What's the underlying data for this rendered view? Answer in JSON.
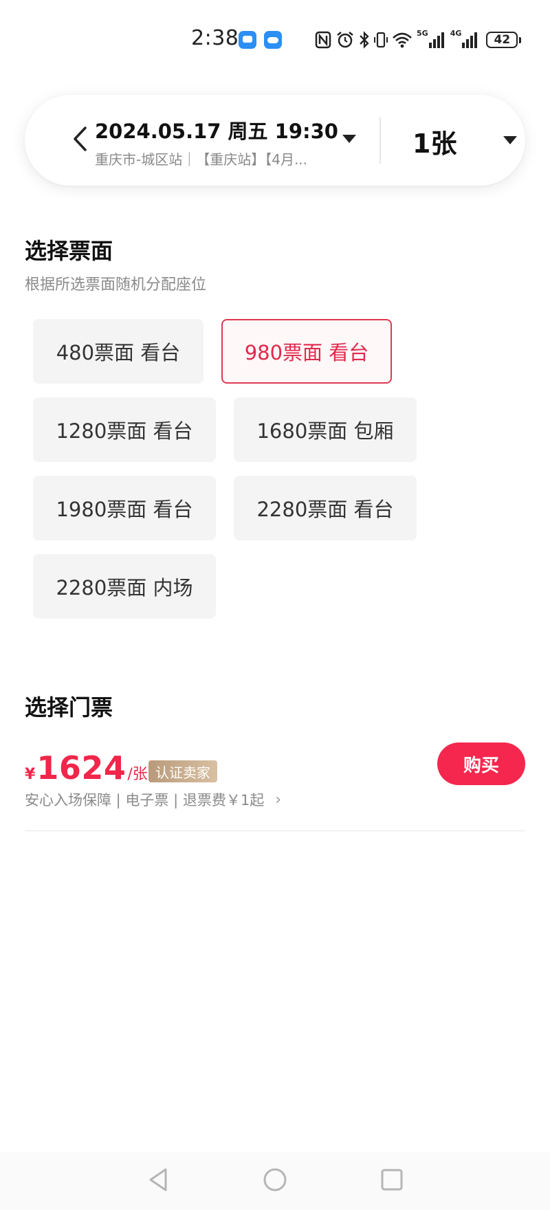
{
  "status_bar": {
    "time": "2:38",
    "network_5g": "5G",
    "network_4g": "4G",
    "battery": "42"
  },
  "header": {
    "session_title": "2024.05.17 周五 19:30",
    "session_subtitle": "重庆市-城区站｜【重庆站】【4月...",
    "quantity": "1张"
  },
  "face_section": {
    "title": "选择票面",
    "subtitle": "根据所选票面随机分配座位",
    "options": [
      {
        "label": "480票面 看台",
        "selected": false
      },
      {
        "label": "980票面 看台",
        "selected": true
      },
      {
        "label": "1280票面 看台",
        "selected": false
      },
      {
        "label": "1680票面 包厢",
        "selected": false
      },
      {
        "label": "1980票面 看台",
        "selected": false
      },
      {
        "label": "2280票面 看台",
        "selected": false
      },
      {
        "label": "2280票面 内场",
        "selected": false
      }
    ]
  },
  "ticket_section": {
    "title": "选择门票",
    "currency": "¥",
    "price": "1624",
    "unit": "/张",
    "seller_badge": "认证卖家",
    "description": "安心入场保障 | 电子票 | 退票费￥1起",
    "description_chevron": "›",
    "buy_label": "购买"
  },
  "colors": {
    "accent": "#f5274e",
    "selected_border": "#e0384f",
    "chip_bg": "#f4f4f4",
    "badge_gold": "#c8ab8c"
  },
  "icons": {
    "back": "chevron-left-icon",
    "dropdown": "caret-down-icon",
    "nav_back": "triangle-back-icon",
    "nav_home": "circle-home-icon",
    "nav_recent": "square-recent-icon"
  }
}
